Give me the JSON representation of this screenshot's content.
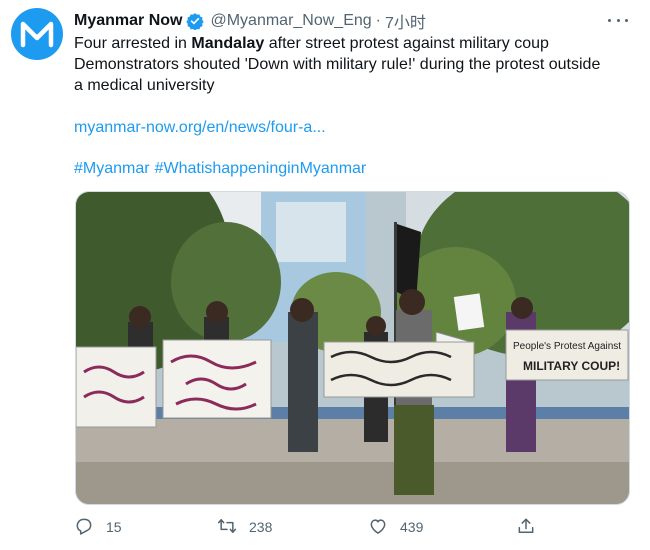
{
  "tweet": {
    "author_name": "Myanmar Now",
    "handle": "@Myanmar_Now_Eng",
    "separator": "·",
    "time": "7小时",
    "text_line1_prefix": "Four arrested in ",
    "text_bold": "Mandalay",
    "text_line1_suffix": " after street protest against military coup",
    "text_line2": "Demonstrators shouted 'Down with military rule!' during the protest outside",
    "text_line3": "a medical university",
    "link": "myanmar-now.org/en/news/four-a...",
    "hashtags": [
      "#Myanmar",
      "#WhatishappeninginMyanmar"
    ],
    "photo": {
      "sign_1": "People's Protest Against",
      "sign_2": "MILITARY COUP!"
    }
  },
  "actions": {
    "reply_count": "15",
    "retweet_count": "238",
    "like_count": "439"
  },
  "colors": {
    "accent": "#1d9bf0",
    "secondary_text": "#536471",
    "text": "#0f1419"
  },
  "icons": [
    "myanmar-now-logo",
    "verified-badge-icon",
    "more-icon",
    "reply-icon",
    "retweet-icon",
    "like-icon",
    "share-icon"
  ]
}
